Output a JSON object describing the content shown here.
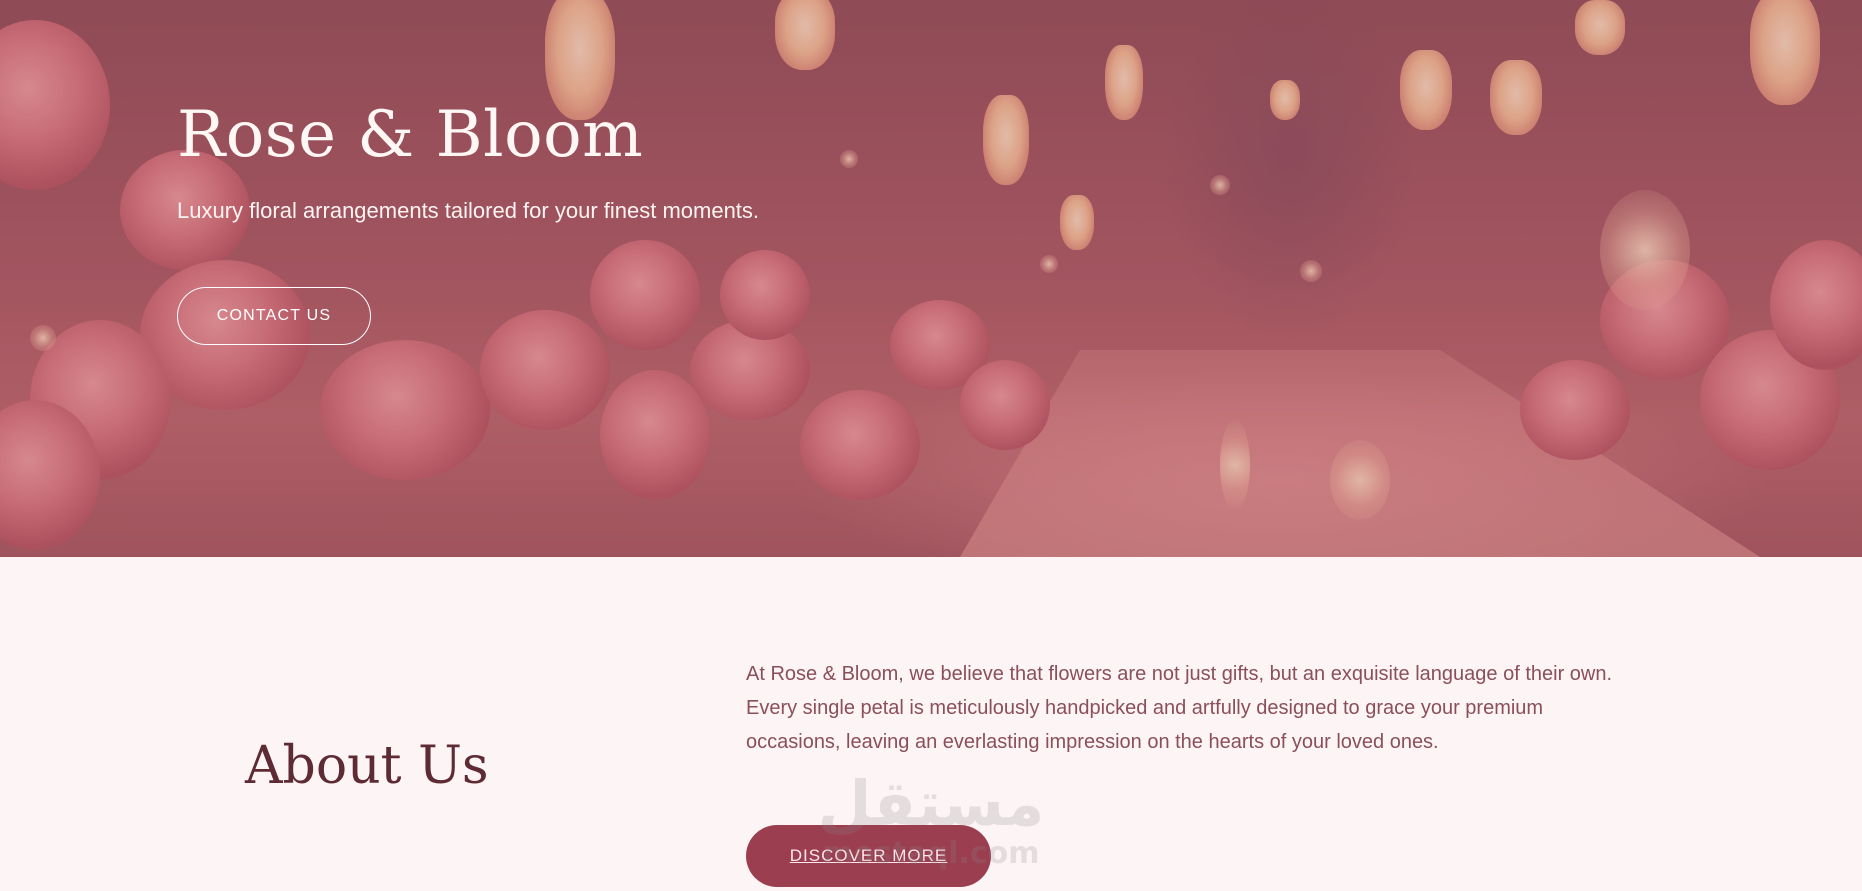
{
  "hero": {
    "title": "Rose & Bloom",
    "subtitle": "Luxury floral arrangements tailored for your finest moments.",
    "contact_label": "CONTACT US"
  },
  "about": {
    "title": "About Us",
    "text": "At Rose & Bloom, we believe that flowers are not just gifts, but an exquisite language of their own. Every single petal is meticulously handpicked and artfully designed to grace your premium occasions, leaving an everlasting impression on the hearts of your loved ones.",
    "discover_label": "DISCOVER MORE"
  },
  "watermark": {
    "arabic": "مستقل",
    "latin": "mostaql.com"
  },
  "colors": {
    "accent": "#9b3e4f",
    "heading": "#5e2a33",
    "body_text": "#8a4f5a",
    "page_bg": "#fdf5f5"
  }
}
